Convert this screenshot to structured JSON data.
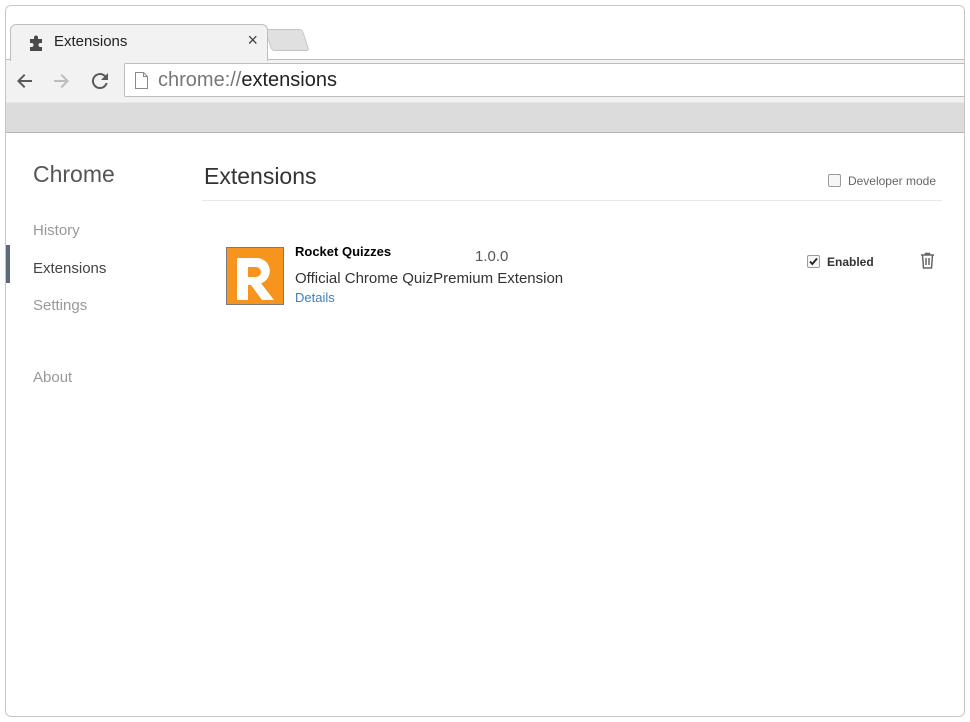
{
  "browser": {
    "tab_title": "Extensions",
    "tab_close": "×",
    "url_scheme": "chrome://",
    "url_path": "extensions"
  },
  "sidebar": {
    "title": "Chrome",
    "items": [
      {
        "label": "History"
      },
      {
        "label": "Extensions"
      },
      {
        "label": "Settings"
      },
      {
        "label": "About"
      }
    ]
  },
  "main": {
    "title": "Extensions",
    "developer_mode_label": "Developer mode",
    "developer_mode_checked": false
  },
  "extensions": [
    {
      "name": "Rocket Quizzes",
      "version": "1.0.0",
      "description": "Official Chrome QuizPremium Extension",
      "details_label": "Details",
      "enabled_label": "Enabled",
      "enabled": true,
      "logo_letter": "R",
      "logo_color": "#f7941d",
      "icon_remove": "trash-icon"
    }
  ]
}
